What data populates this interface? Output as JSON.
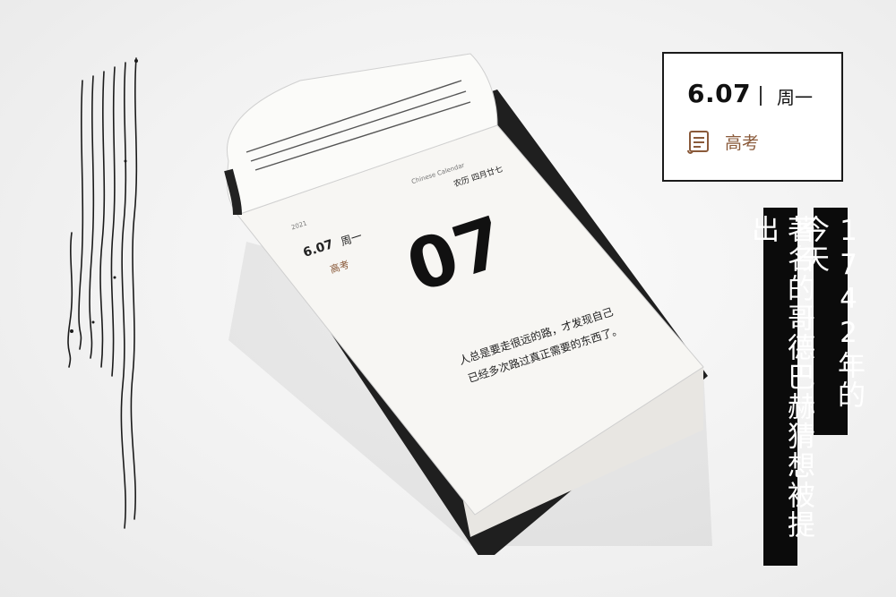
{
  "card": {
    "date": "6.07",
    "weekday": "周一",
    "event": "高考",
    "event_icon": "certificate-scroll-icon",
    "event_color": "#8a5a3a"
  },
  "banners": {
    "line1": "1742年的今天",
    "line2": "著名的哥德巴赫猜想被提出"
  },
  "calendar_page": {
    "date": "6.07",
    "weekday": "周一",
    "event": "高考",
    "big_day": "07",
    "lunar": "农历 四月廿七",
    "quote_line1": "人总是要走很远的路，才发现自己",
    "quote_line2": "已经多次路过真正需要的东西了。",
    "brand": "Chinese Calendar",
    "year": "2021"
  },
  "colors": {
    "accent_brown": "#8a5a3a",
    "banner_bg": "#0b0b0b"
  }
}
